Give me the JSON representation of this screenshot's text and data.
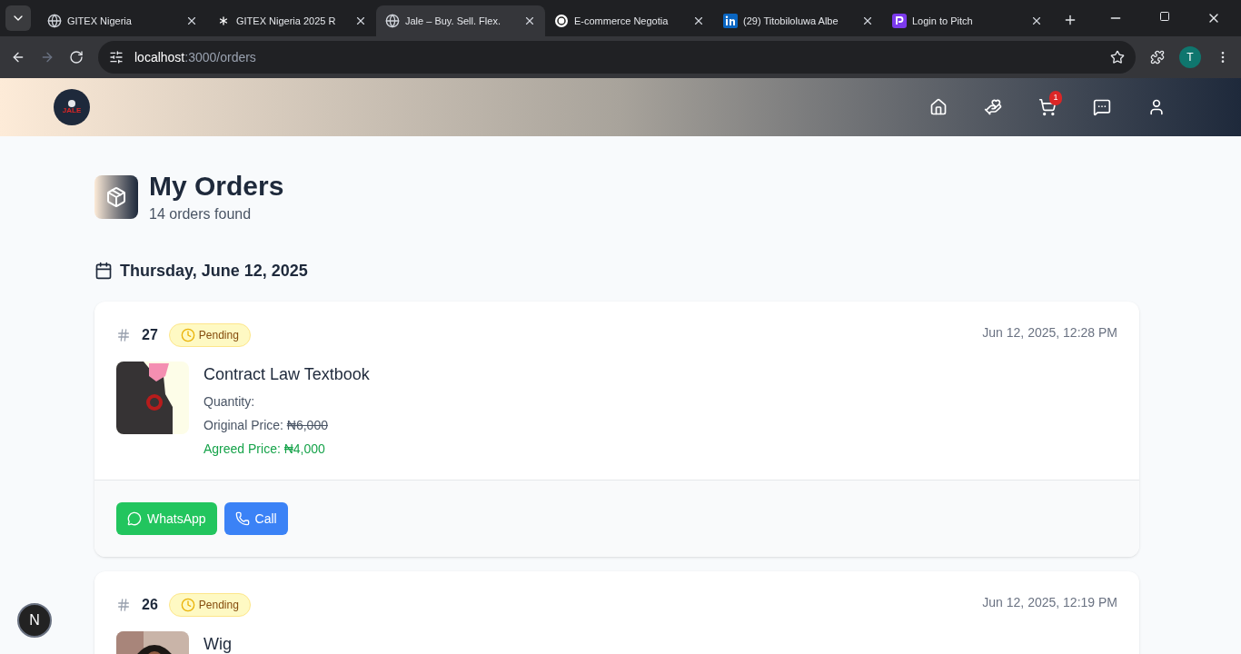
{
  "browser": {
    "tabs": [
      {
        "title": "GITEX Nigeria",
        "selected": false
      },
      {
        "title": "GITEX Nigeria 2025 R",
        "selected": false
      },
      {
        "title": "Jale – Buy. Sell. Flex.",
        "selected": true
      },
      {
        "title": "E-commerce Negotia",
        "selected": false
      },
      {
        "title": "(29) Titobiloluwa Albe",
        "selected": false
      },
      {
        "title": "Login to Pitch",
        "selected": false
      }
    ],
    "url_host": "localhost",
    "url_path": ":3000/orders",
    "profile_initial": "T"
  },
  "header": {
    "logo_text": "JALE",
    "cart_count": "1"
  },
  "page": {
    "title": "My Orders",
    "subtitle": "14 orders found"
  },
  "groups": [
    {
      "date": "Thursday, June 12, 2025",
      "orders": [
        {
          "number": "27",
          "status": "Pending",
          "time": "Jun 12, 2025, 12:28 PM",
          "product": "Contract Law Textbook",
          "quantity_label": "Quantity:",
          "original_price_label": "Original Price:",
          "original_price": "₦6,000",
          "agreed_price_label": "Agreed Price:",
          "agreed_price": "₦4,000",
          "actions": [
            "WhatsApp",
            "Call"
          ]
        },
        {
          "number": "26",
          "status": "Pending",
          "time": "Jun 12, 2025, 12:19 PM",
          "product": "Wig"
        }
      ]
    }
  ],
  "dev_badge": "N"
}
